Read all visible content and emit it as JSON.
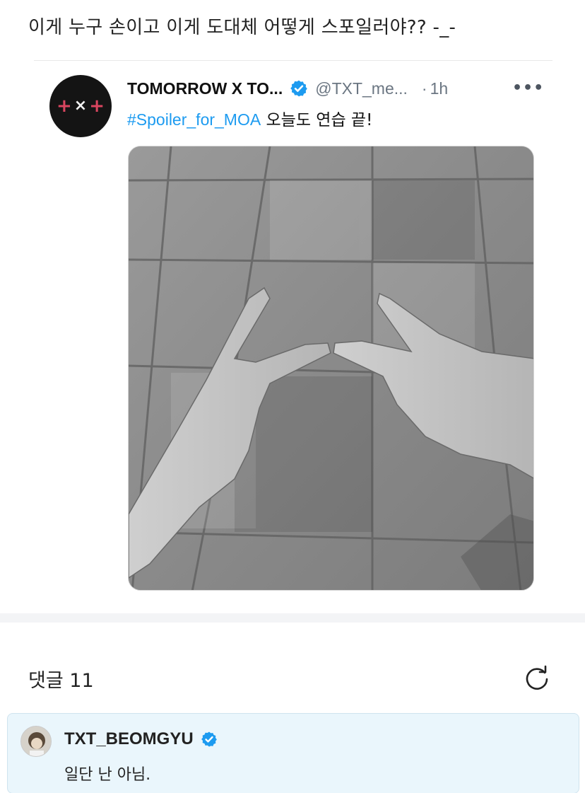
{
  "post": {
    "text": "이게 누구 손이고 이게 도대체 어떻게 스포일러야?? -_-"
  },
  "tweet": {
    "author_name": "TOMORROW X TO...",
    "handle": "@TXT_me...",
    "separator": "·",
    "time": "1h",
    "more": "•••",
    "hashtag": "#Spoiler_for_MOA",
    "text": " 오늘도 연습 끝!",
    "avatar_logo": {
      "plus": "+",
      "x": "×"
    },
    "verified_icon": "verified-badge-icon",
    "media_description_icon": "photo-of-two-hands-v-sign"
  },
  "comments": {
    "title": "댓글 11",
    "refresh_icon": "refresh-icon",
    "items": [
      {
        "author": "TXT_BEOMGYU",
        "text": "일단 난 아님.",
        "verified_icon": "verified-badge-icon"
      }
    ]
  },
  "colors": {
    "hashtag": "#1d9bf0",
    "verified": "#1d9bf0",
    "logo_plus": "#d9455f",
    "comment_bg": "#eaf6fc"
  }
}
